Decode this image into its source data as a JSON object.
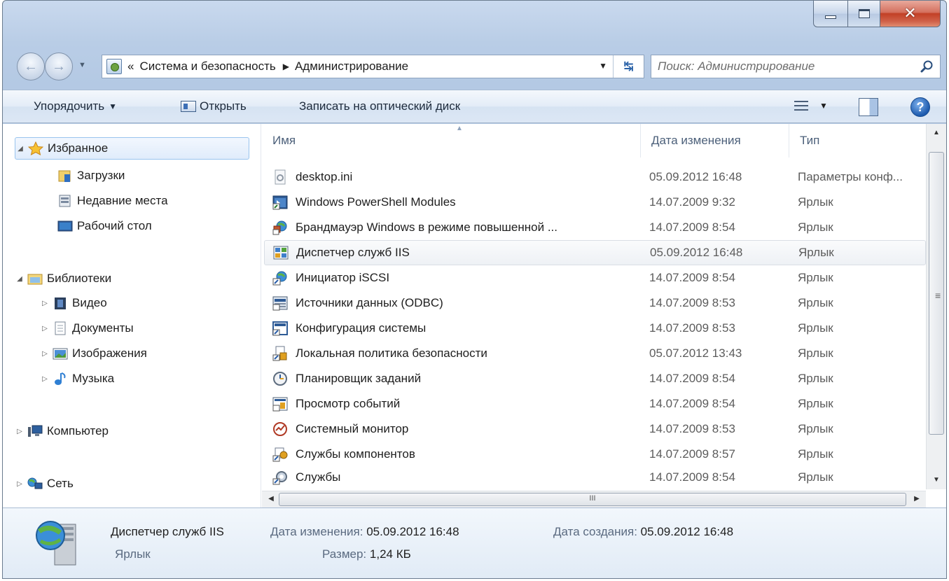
{
  "address": {
    "chevron": "«",
    "crumbs": [
      "Система и безопасность",
      "Администрирование"
    ]
  },
  "search": {
    "placeholder": "Поиск: Администрирование"
  },
  "toolbar": {
    "organize": "Упорядочить",
    "open": "Открыть",
    "burn": "Записать на оптический диск"
  },
  "nav": {
    "favorites": "Избранное",
    "downloads": "Загрузки",
    "recent": "Недавние места",
    "desktop": "Рабочий стол",
    "libraries": "Библиотеки",
    "video": "Видео",
    "documents": "Документы",
    "images": "Изображения",
    "music": "Музыка",
    "computer": "Компьютер",
    "network": "Сеть"
  },
  "columns": {
    "name": "Имя",
    "date": "Дата изменения",
    "type": "Тип"
  },
  "files": [
    {
      "name": "desktop.ini",
      "date": "05.09.2012 16:48",
      "type": "Параметры конф...",
      "icon": "settings-file-icon"
    },
    {
      "name": "Windows PowerShell Modules",
      "date": "14.07.2009 9:32",
      "type": "Ярлык",
      "icon": "powershell-icon"
    },
    {
      "name": "Брандмауэр Windows в режиме повышенной ...",
      "date": "14.07.2009 8:54",
      "type": "Ярлык",
      "icon": "firewall-icon"
    },
    {
      "name": "Диспетчер служб IIS",
      "date": "05.09.2012 16:48",
      "type": "Ярлык",
      "icon": "iis-icon"
    },
    {
      "name": "Инициатор iSCSI",
      "date": "14.07.2009 8:54",
      "type": "Ярлык",
      "icon": "iscsi-icon"
    },
    {
      "name": "Источники данных (ODBC)",
      "date": "14.07.2009 8:53",
      "type": "Ярлык",
      "icon": "odbc-icon"
    },
    {
      "name": "Конфигурация системы",
      "date": "14.07.2009 8:53",
      "type": "Ярлык",
      "icon": "system-config-icon"
    },
    {
      "name": "Локальная политика безопасности",
      "date": "05.07.2012 13:43",
      "type": "Ярлык",
      "icon": "security-policy-icon"
    },
    {
      "name": "Планировщик заданий",
      "date": "14.07.2009 8:54",
      "type": "Ярлык",
      "icon": "task-scheduler-icon"
    },
    {
      "name": "Просмотр событий",
      "date": "14.07.2009 8:54",
      "type": "Ярлык",
      "icon": "event-viewer-icon"
    },
    {
      "name": "Системный монитор",
      "date": "14.07.2009 8:53",
      "type": "Ярлык",
      "icon": "system-monitor-icon"
    },
    {
      "name": "Службы компонентов",
      "date": "14.07.2009 8:57",
      "type": "Ярлык",
      "icon": "component-services-icon"
    },
    {
      "name": "Службы",
      "date": "14.07.2009 8:54",
      "type": "Ярлык",
      "icon": "services-icon"
    }
  ],
  "details": {
    "name": "Диспетчер служб IIS",
    "kind": "Ярлык",
    "modified_label": "Дата изменения:",
    "modified_value": "05.09.2012 16:48",
    "created_label": "Дата создания:",
    "created_value": "05.09.2012 16:48",
    "size_label": "Размер:",
    "size_value": "1,24 КБ"
  },
  "hscroll_grip": "III",
  "vscroll_grip": "≡"
}
